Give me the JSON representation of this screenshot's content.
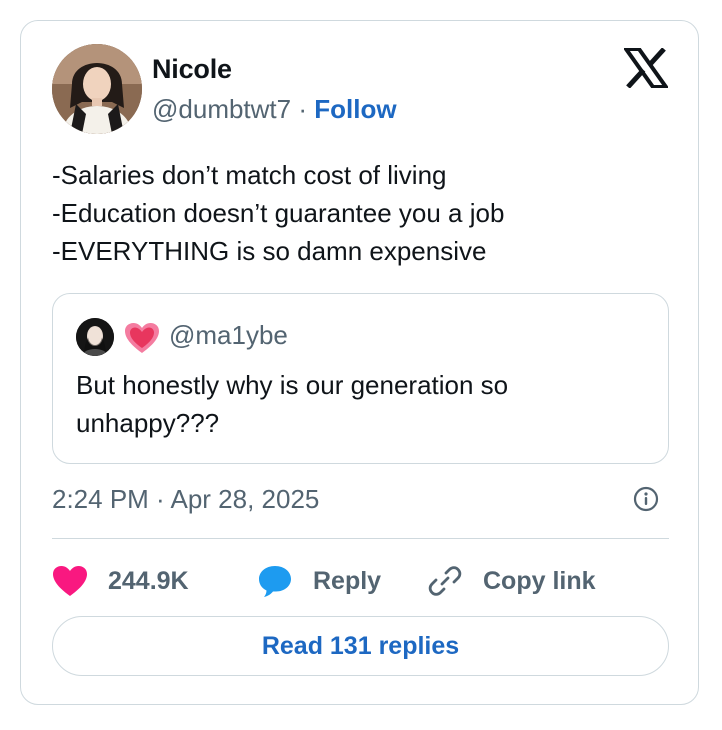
{
  "tweet": {
    "author": {
      "name": "Nicole",
      "handle": "@dumbtwt7",
      "separator": "·",
      "follow_label": "Follow"
    },
    "text": "-Salaries don’t match cost of living\n-Education doesn’t guarantee you a job\n-EVERYTHING is so damn expensive",
    "quoted": {
      "handle": "@ma1ybe",
      "text": "But honestly why is our generation so unhappy???"
    },
    "timestamp": "2:24 PM · Apr 28, 2025",
    "actions": {
      "likes": "244.9K",
      "reply_label": "Reply",
      "copy_label": "Copy link"
    },
    "read_replies_label": "Read 131 replies"
  },
  "colors": {
    "accent": "#1d68c2",
    "heart": "#f91880",
    "reply_icon": "#1d9bf0",
    "muted": "#536471",
    "border": "#cfd9de"
  },
  "icons": [
    "x-logo-icon",
    "info-icon",
    "heart-icon",
    "reply-icon",
    "link-icon",
    "heart-emoji-icon"
  ]
}
